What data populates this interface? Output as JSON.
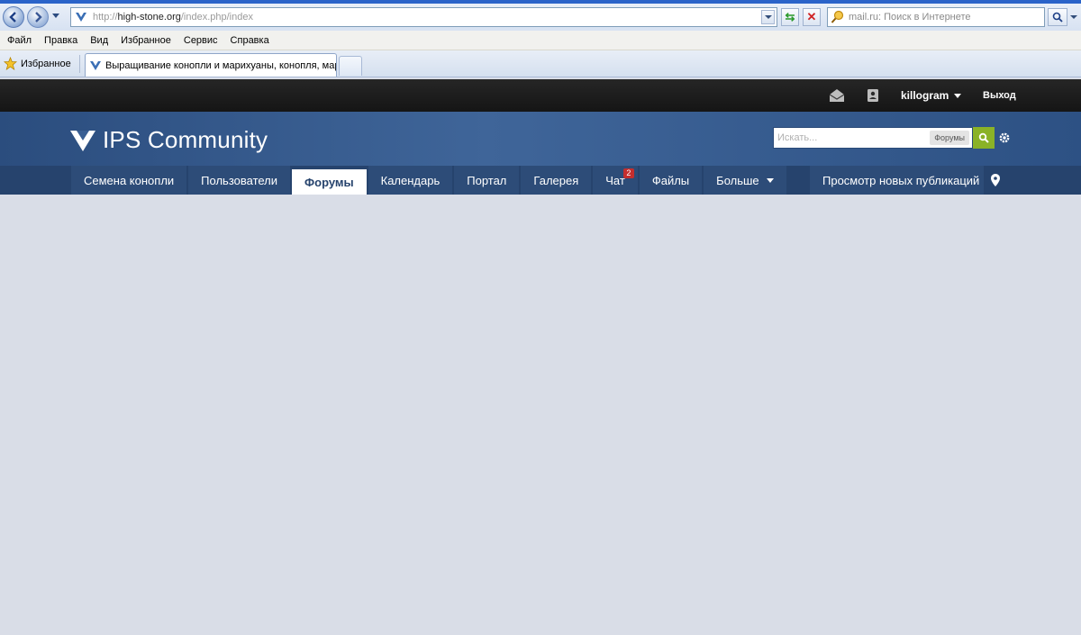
{
  "browser": {
    "address": {
      "prefix": "http://",
      "host": "high-stone.org",
      "path": "/index.php/index"
    },
    "search": {
      "placeholder": "mail.ru: Поиск в Интернете"
    },
    "menu": [
      "Файл",
      "Правка",
      "Вид",
      "Избранное",
      "Сервис",
      "Справка"
    ],
    "favorites_label": "Избранное",
    "tab_title": "Выращивание конопли и марихуаны, конопля, мар..."
  },
  "site": {
    "user": {
      "username": "killogram",
      "signout_label": "Выход"
    },
    "brand": {
      "name": "IPS Community"
    },
    "search": {
      "placeholder": "Искать...",
      "scope": "Форумы"
    },
    "nav": {
      "items": [
        {
          "label": "Семена конопли"
        },
        {
          "label": "Пользователи"
        },
        {
          "label": "Форумы",
          "active": true
        },
        {
          "label": "Календарь"
        },
        {
          "label": "Портал"
        },
        {
          "label": "Галерея"
        },
        {
          "label": "Чат",
          "badge": "2"
        },
        {
          "label": "Файлы"
        },
        {
          "label": "Больше",
          "dropdown": true
        }
      ],
      "view_new": "Просмотр новых публикаций"
    },
    "colors": {
      "header_dark": "#1c1c1c",
      "brand_blue": "#3f6599",
      "nav_blue": "#26436d",
      "search_green": "#8ab227",
      "badge_red": "#c42e2e",
      "page_bg": "#d9dde7"
    }
  }
}
